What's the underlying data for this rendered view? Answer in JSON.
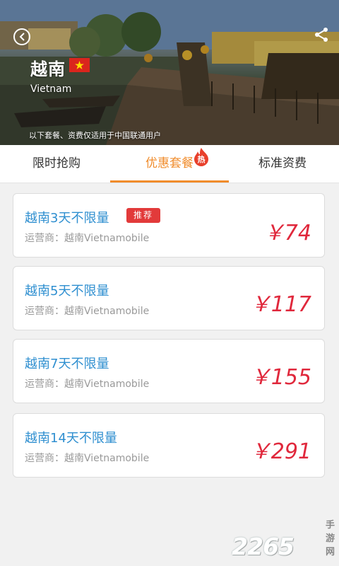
{
  "hero": {
    "country_zh": "越南",
    "country_en": "Vietnam",
    "note": "以下套餐、资费仅适用于中国联通用户",
    "back_icon": "back-arrow-icon",
    "share_icon": "share-icon",
    "flag": "vietnam-flag"
  },
  "tabs": [
    {
      "label": "限时抢购",
      "active": false
    },
    {
      "label": "优惠套餐",
      "active": true,
      "badge": "热"
    },
    {
      "label": "标准资费",
      "active": false
    }
  ],
  "packages": [
    {
      "name": "越南3天不限量",
      "operator": "运营商：越南Vietnamobile",
      "price": "￥74",
      "badge": "推荐"
    },
    {
      "name": "越南5天不限量",
      "operator": "运营商：越南Vietnamobile",
      "price": "￥117"
    },
    {
      "name": "越南7天不限量",
      "operator": "运营商：越南Vietnamobile",
      "price": "￥155"
    },
    {
      "name": "越南14天不限量",
      "operator": "运营商：越南Vietnamobile",
      "price": "￥291"
    }
  ],
  "watermark": {
    "number": "2265",
    "text": "手游网"
  },
  "colors": {
    "accent": "#f08c2c",
    "price": "#e0283c",
    "name": "#2f8fd0",
    "badge": "#e23a3a"
  }
}
